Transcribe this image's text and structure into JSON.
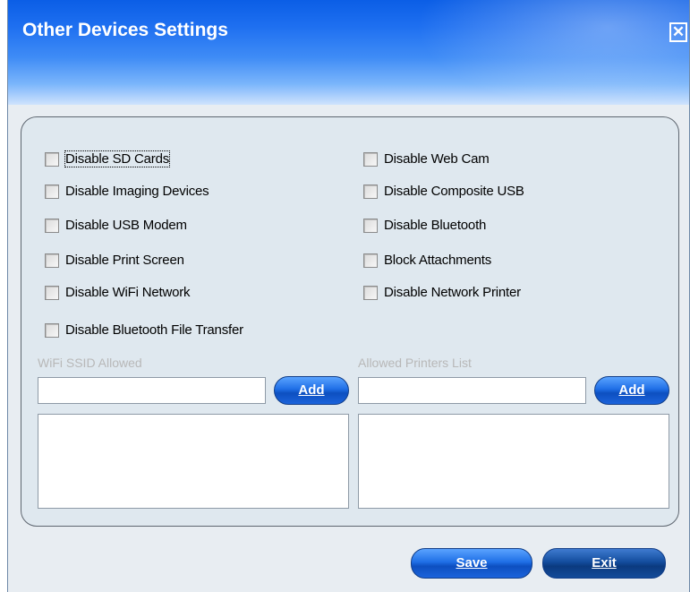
{
  "window": {
    "title": "Other Devices Settings",
    "close_glyph": "✕"
  },
  "checkboxes": {
    "left": [
      "Disable SD Cards",
      "Disable Imaging Devices",
      "Disable USB Modem",
      "Disable Print Screen",
      "Disable WiFi Network",
      "Disable Bluetooth File Transfer"
    ],
    "right": [
      "Disable Web Cam",
      "Disable Composite USB",
      "Disable Bluetooth",
      "Block Attachments",
      "Disable Network Printer"
    ]
  },
  "wifi": {
    "label": "WiFi SSID Allowed",
    "input_value": "",
    "add_label": "Add"
  },
  "printers": {
    "label": "Allowed Printers List",
    "input_value": "",
    "add_label": "Add"
  },
  "footer": {
    "save_label": "Save",
    "exit_label": "Exit"
  },
  "colors": {
    "title_blue": "#0b5ee6",
    "button_blue": "#1f6fe6",
    "panel_bg": "#dfe8ef"
  }
}
